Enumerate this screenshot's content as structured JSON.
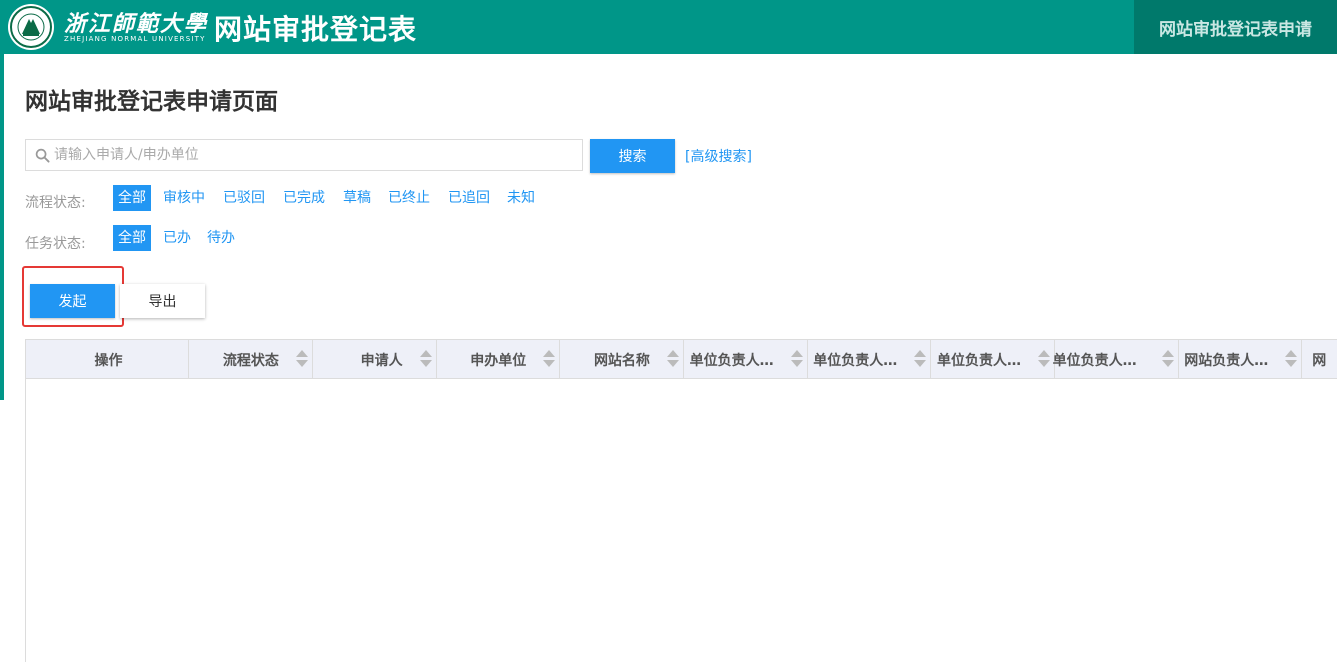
{
  "header": {
    "university_name_cn": "浙江師範大學",
    "university_name_en": "ZHEJIANG NORMAL UNIVERSITY",
    "app_title": "网站审批登记表",
    "nav_right_label": "网站审批登记表申请",
    "brand_color": "#009688"
  },
  "page": {
    "title": "网站审批登记表申请页面"
  },
  "search": {
    "placeholder": "请输入申请人/申办单位",
    "value": "",
    "button_label": "搜索",
    "advanced_link": "[高级搜索]"
  },
  "filters": {
    "flow_status": {
      "label": "流程状态:",
      "options": [
        "全部",
        "审核中",
        "已驳回",
        "已完成",
        "草稿",
        "已终止",
        "已追回",
        "未知"
      ],
      "selected": "全部"
    },
    "task_status": {
      "label": "任务状态:",
      "options": [
        "全部",
        "已办",
        "待办"
      ],
      "selected": "全部"
    }
  },
  "actions": {
    "launch_label": "发起",
    "export_label": "导出"
  },
  "table": {
    "columns": [
      "操作",
      "流程状态",
      "申请人",
      "申办单位",
      "网站名称",
      "单位负责人…",
      "单位负责人…",
      "单位负责人…",
      "单位负责人e…",
      "网站负责人…",
      "网"
    ],
    "rows": []
  },
  "colors": {
    "accent": "#2196f3",
    "highlight": "#e53935",
    "header_dark": "#00796b"
  }
}
